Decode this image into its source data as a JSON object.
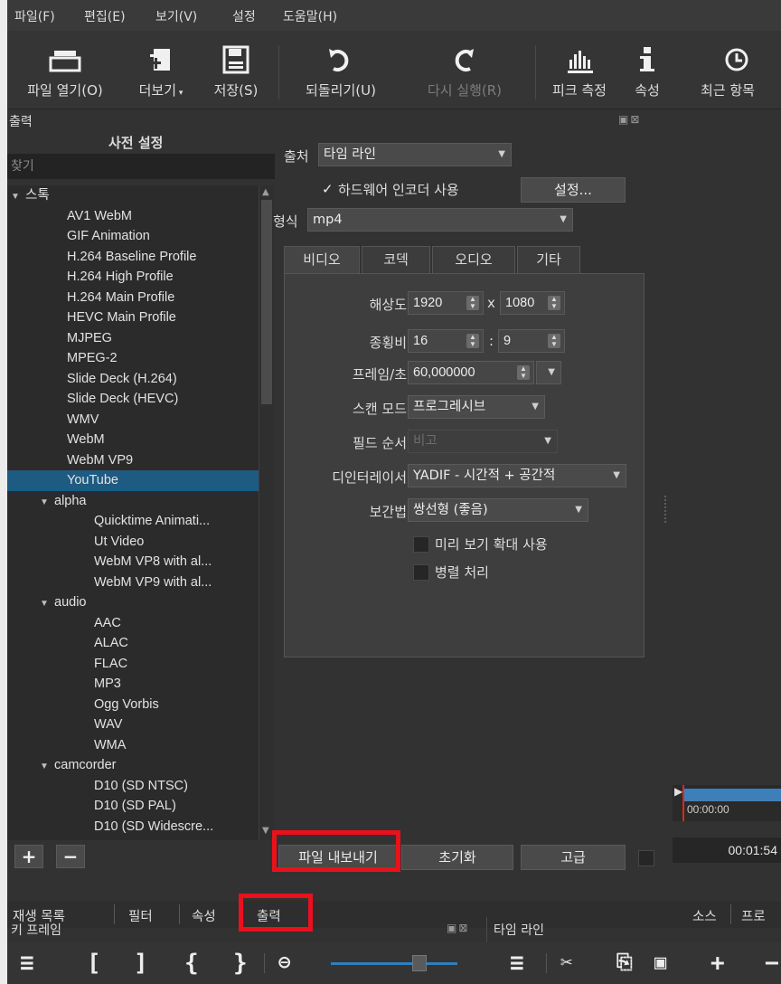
{
  "menubar": [
    "파일(F)",
    "편집(E)",
    "보기(V)",
    "설정",
    "도움말(H)"
  ],
  "toolbar": {
    "open": "파일 열기(O)",
    "more": "더보기",
    "save": "저장(S)",
    "undo": "되돌리기(U)",
    "redo": "다시 실행(R)",
    "peak": "피크 측정",
    "properties": "속성",
    "recent": "최근 항목"
  },
  "export_panel": {
    "title": "출력",
    "presets_title": "사전 설정",
    "search_placeholder": "찾기",
    "presets": [
      {
        "label": "스톡",
        "type": "category",
        "indent": 0
      },
      {
        "label": "AV1 WebM",
        "indent": 1
      },
      {
        "label": "GIF Animation",
        "indent": 1
      },
      {
        "label": "H.264 Baseline Profile",
        "indent": 1
      },
      {
        "label": "H.264 High Profile",
        "indent": 1
      },
      {
        "label": "H.264 Main Profile",
        "indent": 1
      },
      {
        "label": "HEVC Main Profile",
        "indent": 1
      },
      {
        "label": "MJPEG",
        "indent": 1
      },
      {
        "label": "MPEG-2",
        "indent": 1
      },
      {
        "label": "Slide Deck (H.264)",
        "indent": 1
      },
      {
        "label": "Slide Deck (HEVC)",
        "indent": 1
      },
      {
        "label": "WMV",
        "indent": 1
      },
      {
        "label": "WebM",
        "indent": 1
      },
      {
        "label": "WebM VP9",
        "indent": 1
      },
      {
        "label": "YouTube",
        "indent": 1,
        "selected": true
      },
      {
        "label": "alpha",
        "type": "category",
        "indent": 1
      },
      {
        "label": "Quicktime Animati...",
        "indent": 2
      },
      {
        "label": "Ut Video",
        "indent": 2
      },
      {
        "label": "WebM VP8 with al...",
        "indent": 2
      },
      {
        "label": "WebM VP9 with al...",
        "indent": 2
      },
      {
        "label": "audio",
        "type": "category",
        "indent": 1
      },
      {
        "label": "AAC",
        "indent": 2
      },
      {
        "label": "ALAC",
        "indent": 2
      },
      {
        "label": "FLAC",
        "indent": 2
      },
      {
        "label": "MP3",
        "indent": 2
      },
      {
        "label": "Ogg Vorbis",
        "indent": 2
      },
      {
        "label": "WAV",
        "indent": 2
      },
      {
        "label": "WMA",
        "indent": 2
      },
      {
        "label": "camcorder",
        "type": "category",
        "indent": 1
      },
      {
        "label": "D10 (SD NTSC)",
        "indent": 2
      },
      {
        "label": "D10 (SD PAL)",
        "indent": 2
      },
      {
        "label": "D10 (SD Widescre...",
        "indent": 2
      }
    ],
    "source_label": "출처",
    "source_value": "타임 라인",
    "hw_encoder_label": "하드웨어 인코더 사용",
    "settings_button": "설정...",
    "format_label": "형식",
    "format_value": "mp4",
    "tabs": [
      "비디오",
      "코덱",
      "오디오",
      "기타"
    ],
    "video": {
      "resolution_label": "해상도",
      "width": "1920",
      "height": "1080",
      "x_sep": "x",
      "aspect_label": "종횡비",
      "aspect_w": "16",
      "aspect_h": "9",
      "colon": ":",
      "fps_label": "프레임/초",
      "fps": "60,000000",
      "scan_label": "스캔 모드",
      "scan_value": "프로그레시브",
      "field_label": "필드 순서",
      "field_value": "비고",
      "deinterlace_label": "디인터레이서",
      "deinterlace_value": "YADIF - 시간적 + 공간적",
      "interp_label": "보간법",
      "interp_value": "쌍선형 (좋음)",
      "preview_scale_label": "미리 보기 확대 사용",
      "parallel_label": "병렬 처리"
    },
    "export_button": "파일 내보내기",
    "reset_button": "초기화",
    "advanced_button": "고급"
  },
  "timecode_start": "00:00:00",
  "timecode_duration": "00:01:54",
  "bottom_tabs": [
    "재생 목록",
    "필터",
    "속성",
    "출력"
  ],
  "right_tabs": [
    "소스",
    "프로"
  ],
  "keyframes_title": "키 프레임",
  "timeline_title": "타임 라인",
  "colors": {
    "selection": "#1d5b82",
    "highlight": "#e8121b",
    "accent": "#2f7fbf"
  }
}
